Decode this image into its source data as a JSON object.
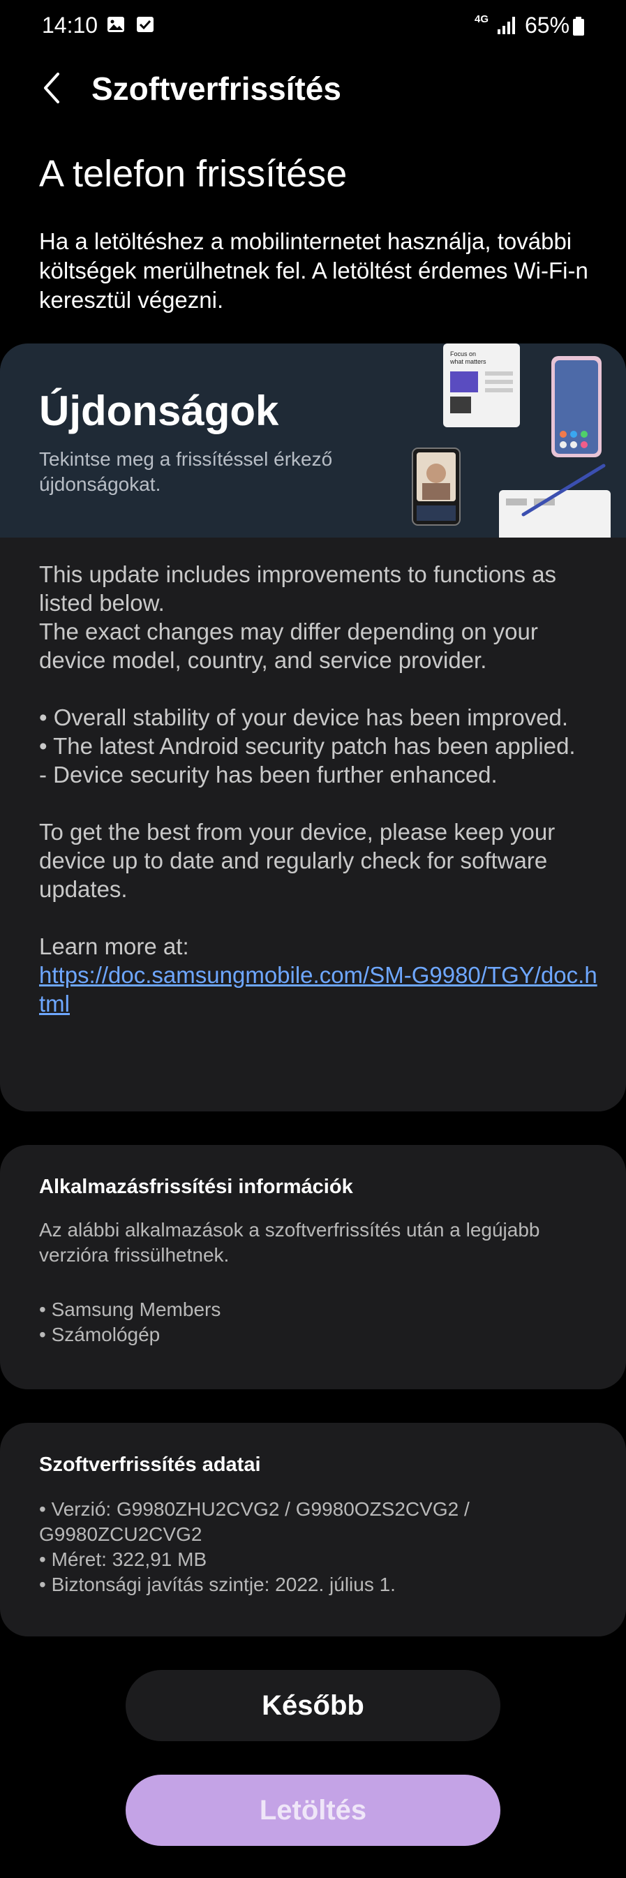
{
  "status_bar": {
    "time": "14:10",
    "battery": "65%",
    "network": "4G",
    "icons": [
      "gallery-icon",
      "check-box-icon",
      "signal-icon",
      "battery-icon"
    ]
  },
  "app_bar": {
    "title": "Szoftverfrissítés",
    "back_icon": "chevron-left-icon"
  },
  "heading": "A telefon frissítése",
  "intro": "Ha a letöltéshez a mobilinternetet használja, további költségek merülhetnek fel. A letöltést érdemes Wi-Fi-n keresztül végezni.",
  "whats_new": {
    "title": "Újdonságok",
    "subtitle": "Tekintse meg a frissítéssel érkező újdonságokat.",
    "banner_tile_title": "Focus on what matters",
    "notes": {
      "p1": "This update includes improvements to functions as listed below.",
      "p2": "The exact changes may differ depending on your device model, country, and service provider.",
      "b1": "• Overall stability of your device has been improved.",
      "b2": "• The latest Android security patch has been applied.",
      "b3": "- Device security has been further enhanced.",
      "p3": "To get the best from your device, please keep your device up to date and regularly check for software updates.",
      "learn_more": "Learn more at:",
      "link": "https://doc.samsungmobile.com/SM-G9980/TGY/doc.html"
    }
  },
  "app_update_info": {
    "title": "Alkalmazásfrissítési információk",
    "text": "Az alábbi alkalmazások a szoftverfrissítés után a legújabb verzióra frissülhetnek.",
    "apps": [
      "• Samsung Members",
      "• Számológép"
    ]
  },
  "update_details": {
    "title": "Szoftverfrissítés adatai",
    "version": "• Verzió: G9980ZHU2CVG2 / G9980OZS2CVG2 / G9980ZCU2CVG2",
    "size": "• Méret: 322,91 MB",
    "security": "• Biztonsági javítás szintje: 2022. július 1."
  },
  "buttons": {
    "later": "Később",
    "download": "Letöltés"
  },
  "colors": {
    "background": "#000000",
    "card": "#1c1c1e",
    "banner": "#1f2a36",
    "link": "#6ea7ff",
    "download_button": "#c4a3e6"
  }
}
